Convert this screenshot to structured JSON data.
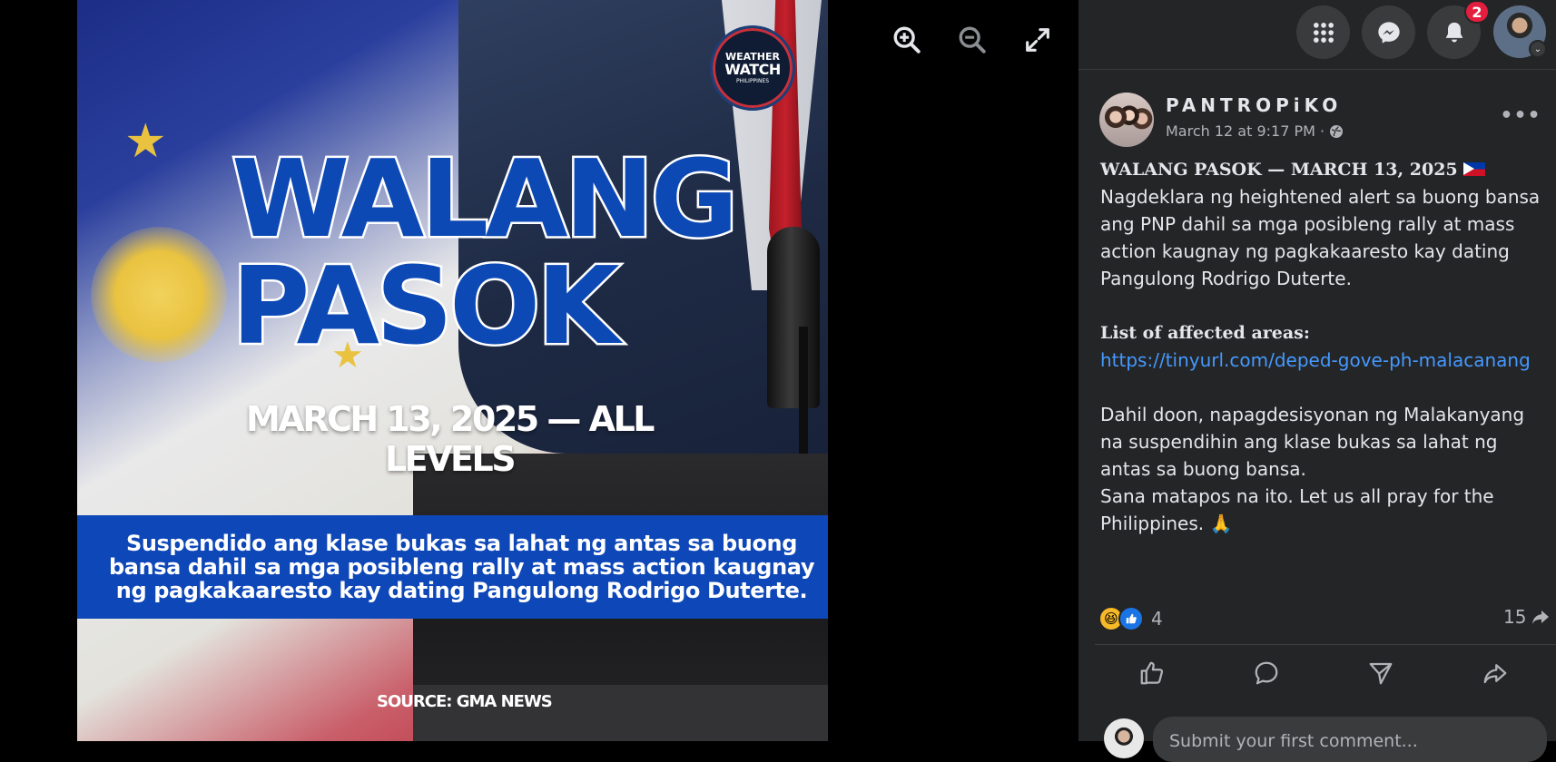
{
  "viewer": {
    "zoom_in_label": "Zoom in",
    "zoom_out_label": "Zoom out",
    "fullscreen_label": "Enter full screen"
  },
  "image": {
    "logo_line1": "WEATHER",
    "logo_line2": "WATCH",
    "logo_line3": "PHILIPPINES",
    "headline_line1": "WALANG",
    "headline_line2": "PASOK",
    "date_line": "MARCH 13, 2025 — ALL LEVELS",
    "band_text": "Suspendido ang klase bukas sa lahat ng antas sa buong bansa dahil sa mga posibleng rally at mass action kaugnay ng pagkakaaresto kay dating Pangulong Rodrigo Duterte.",
    "source": "SOURCE: GMA NEWS"
  },
  "topbar": {
    "menu_icon": "grid-menu-icon",
    "messenger_icon": "messenger-icon",
    "notifications_icon": "bell-icon",
    "notification_count": "2",
    "account_chevron": "⌄"
  },
  "post": {
    "author": "PANTROPiKO",
    "timestamp": "March 12 at 9:17 PM ·",
    "more_label": "•••",
    "headline": "WALANG PASOK — MARCH 13, 2025",
    "paragraph1": "Nagdeklara ng heightened alert sa buong bansa ang PNP dahil sa mga posibleng rally at mass action kaugnay ng pagkakaaresto kay dating Pangulong Rodrigo Duterte.",
    "list_heading": "List of affected areas:",
    "link": "https://tinyurl.com/deped-gove-ph-malacanang",
    "paragraph2": "Dahil doon, napagdesisyonan ng Malakanyang na suspendihin ang klase bukas sa lahat ng antas sa buong bansa.",
    "paragraph3": "Sana matapos na ito. Let us all pray for the Philippines. 🙏",
    "reaction_count": "4",
    "share_count": "15",
    "comment_placeholder": "Submit your first comment..."
  },
  "colors": {
    "panel_bg": "#242526",
    "text_primary": "#e4e6eb",
    "text_secondary": "#b0b3b8",
    "link": "#4599ff",
    "badge_red": "#e41e3f",
    "image_band_blue": "#0e47b7"
  }
}
